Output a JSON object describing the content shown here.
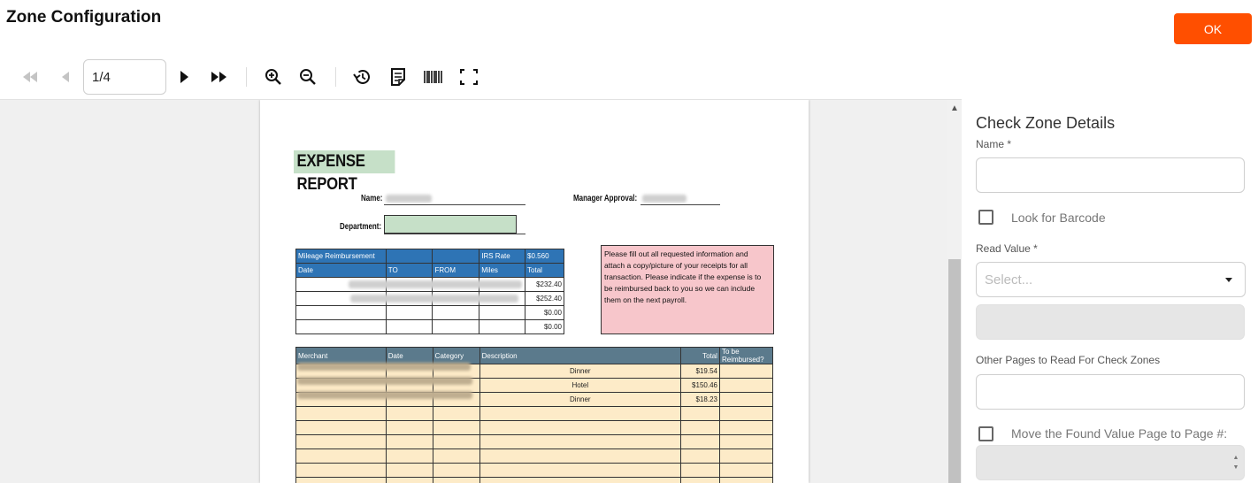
{
  "header": {
    "title": "Zone Configuration",
    "ok_label": "OK"
  },
  "toolbar": {
    "page_value": "1/4",
    "icons": [
      "first-page-icon",
      "previous-page-icon",
      "next-page-icon",
      "last-page-icon",
      "zoom-in-icon",
      "zoom-out-icon",
      "history-icon",
      "document-note-icon",
      "barcode-icon",
      "fullscreen-icon"
    ]
  },
  "document": {
    "title": "EXPENSE REPORT",
    "name_label": "Name:",
    "manager_label": "Manager Approval:",
    "department_label": "Department:",
    "mileage": {
      "header1": [
        "Mileage Reimbursement",
        "",
        "",
        "IRS Rate",
        "$0.560"
      ],
      "header2": [
        "Date",
        "TO",
        "FROM",
        "Miles",
        "Total"
      ],
      "totals": [
        "$232.40",
        "$252.40",
        "$0.00",
        "$0.00"
      ]
    },
    "note": "Please fill out all requested information and attach a copy/picture of your receipts for all transaction. Please indicate if the expense is to be reimbursed back to you so we can include them on the next payroll.",
    "expenses": {
      "headers": [
        "Merchant",
        "Date",
        "Category",
        "Description",
        "Total",
        "To be Reimbursed?"
      ],
      "rows": [
        {
          "description": "Dinner",
          "total": "$19.54"
        },
        {
          "description": "Hotel",
          "total": "$150.46"
        },
        {
          "description": "Dinner",
          "total": "$18.23"
        }
      ]
    }
  },
  "panel": {
    "title": "Check Zone Details",
    "name_label": "Name *",
    "name_value": "",
    "look_for_barcode_label": "Look for Barcode",
    "read_value_label": "Read Value *",
    "read_value_placeholder": "Select...",
    "other_pages_label": "Other Pages to Read For Check Zones",
    "other_pages_value": "",
    "move_found_label": "Move the Found Value Page to Page #:"
  },
  "colors": {
    "accent": "#ff4f00",
    "doc_green": "#c6e0c8",
    "doc_blue": "#2e74b5",
    "doc_pink": "#f7c6cb",
    "doc_yellow": "#fdebc8"
  }
}
